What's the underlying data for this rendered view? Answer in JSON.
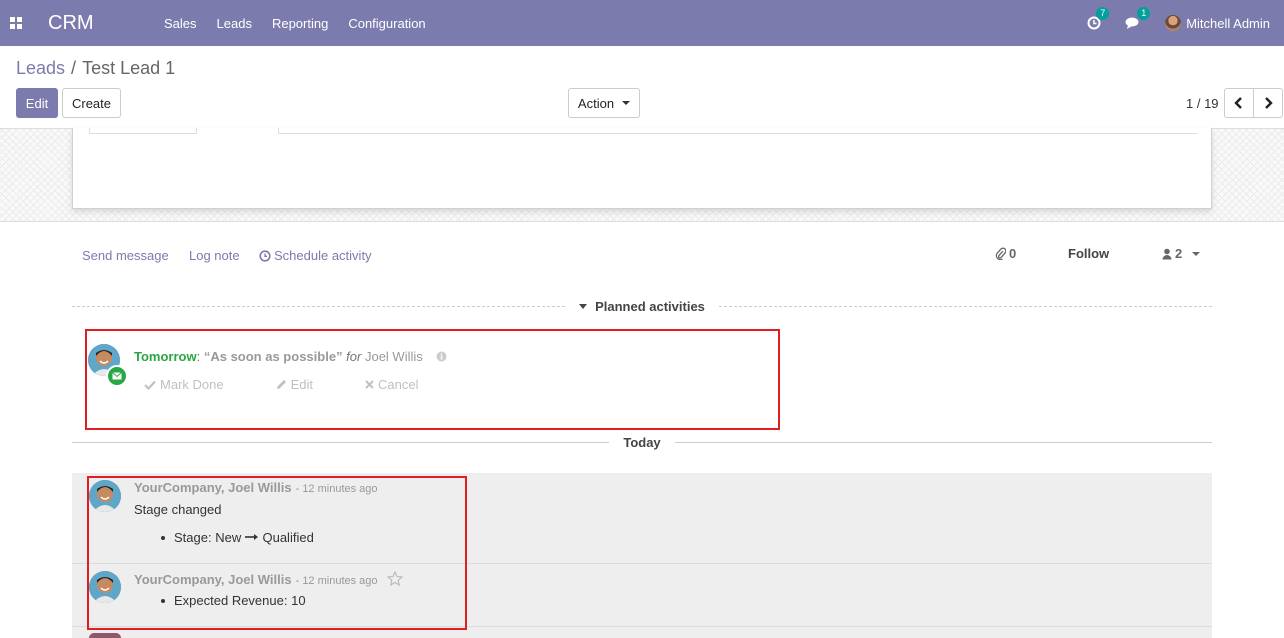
{
  "navbar": {
    "brand": "CRM",
    "menu": [
      "Sales",
      "Leads",
      "Reporting",
      "Configuration"
    ],
    "activity_count": "7",
    "message_count": "1",
    "user_name": "Mitchell Admin"
  },
  "breadcrumb": {
    "parent": "Leads",
    "separator": "/",
    "current": "Test Lead 1"
  },
  "buttons": {
    "edit": "Edit",
    "create": "Create",
    "action": "Action"
  },
  "pager": {
    "value": "1 / 19"
  },
  "chatter": {
    "send_message": "Send message",
    "log_note": "Log note",
    "schedule_activity": "Schedule activity",
    "attachments_count": "0",
    "follow": "Follow",
    "followers_count": "2"
  },
  "planned_activities": {
    "header": "Planned activities",
    "item": {
      "date": "Tomorrow",
      "colon": ":",
      "summary": "“As soon as possible”",
      "for_label": "for",
      "assignee": "Joel Willis",
      "mark_done": "Mark Done",
      "edit": "Edit",
      "cancel": "Cancel"
    }
  },
  "today_label": "Today",
  "messages": [
    {
      "author": "YourCompany, Joel Willis",
      "date": "- 12 minutes ago",
      "body": "Stage changed",
      "tracking_label": "Stage:",
      "tracking_old": "New",
      "tracking_new": "Qualified"
    },
    {
      "author": "YourCompany, Joel Willis",
      "date": "- 12 minutes ago",
      "tracking_label": "Expected Revenue:",
      "tracking_new": "10"
    }
  ],
  "colors": {
    "navbar": "#7c7bad",
    "primary": "#7c7bad",
    "accent": "#00a09d",
    "success": "#28a745",
    "highlight_box": "#e02020"
  }
}
